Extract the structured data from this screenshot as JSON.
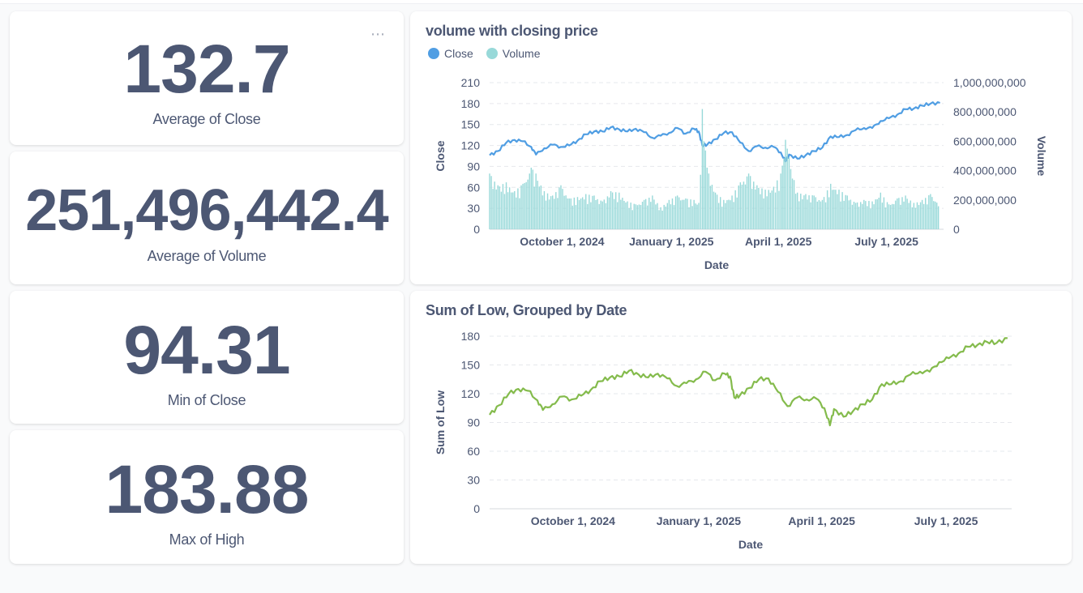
{
  "scalars": {
    "avg_close": {
      "value": "132.7",
      "label": "Average of Close"
    },
    "avg_volume": {
      "value": "251,496,442.4",
      "label": "Average of Volume"
    },
    "min_close": {
      "value": "94.31",
      "label": "Min of Close"
    },
    "max_high": {
      "value": "183.88",
      "label": "Max of High"
    }
  },
  "card_menu_icon": "ellipsis-icon",
  "colors": {
    "close": "#509ee3",
    "volume": "#98d9d9",
    "low": "#84bb4c",
    "text": "#4c5773",
    "grid": "#e6e8ec"
  },
  "chart_data": [
    {
      "type": "line",
      "title": "volume with closing price",
      "legend": [
        "Close",
        "Volume"
      ],
      "legend_position": "top-left",
      "xlabel": "Date",
      "ylabel": "Close",
      "y2label": "Volume",
      "x_ticks": [
        "October 1, 2024",
        "January 1, 2025",
        "April 1, 2025",
        "July 1, 2025"
      ],
      "y_ticks": [
        "0",
        "30",
        "60",
        "90",
        "120",
        "150",
        "180",
        "210"
      ],
      "y2_ticks": [
        "0",
        "200,000,000",
        "400,000,000",
        "600,000,000",
        "800,000,000",
        "1,000,000,000"
      ],
      "ylim": [
        0,
        210
      ],
      "y2lim": [
        0,
        1000000000
      ],
      "xlim": [
        "2024-08-01",
        "2025-08-18"
      ],
      "grid": true,
      "series": [
        {
          "name": "Close",
          "kind": "line",
          "axis": "left",
          "points": [
            [
              "2024-08-01",
              106
            ],
            [
              "2024-08-08",
              112
            ],
            [
              "2024-08-15",
              124
            ],
            [
              "2024-08-22",
              128
            ],
            [
              "2024-08-29",
              126
            ],
            [
              "2024-09-05",
              118
            ],
            [
              "2024-09-09",
              107
            ],
            [
              "2024-09-16",
              116
            ],
            [
              "2024-09-23",
              121
            ],
            [
              "2024-09-30",
              118
            ],
            [
              "2024-10-07",
              120
            ],
            [
              "2024-10-14",
              127
            ],
            [
              "2024-10-21",
              136
            ],
            [
              "2024-10-28",
              140
            ],
            [
              "2024-11-04",
              140
            ],
            [
              "2024-11-11",
              146
            ],
            [
              "2024-11-18",
              143
            ],
            [
              "2024-11-25",
              140
            ],
            [
              "2024-12-02",
              144
            ],
            [
              "2024-12-09",
              139
            ],
            [
              "2024-12-16",
              131
            ],
            [
              "2024-12-23",
              134
            ],
            [
              "2024-12-30",
              138
            ],
            [
              "2025-01-06",
              145
            ],
            [
              "2025-01-13",
              137
            ],
            [
              "2025-01-20",
              144
            ],
            [
              "2025-01-24",
              140
            ],
            [
              "2025-01-27",
              120
            ],
            [
              "2025-01-31",
              121
            ],
            [
              "2025-02-07",
              129
            ],
            [
              "2025-02-14",
              138
            ],
            [
              "2025-02-21",
              139
            ],
            [
              "2025-02-28",
              124
            ],
            [
              "2025-03-07",
              112
            ],
            [
              "2025-03-14",
              119
            ],
            [
              "2025-03-21",
              117
            ],
            [
              "2025-03-28",
              118
            ],
            [
              "2025-04-03",
              110
            ],
            [
              "2025-04-07",
              97
            ],
            [
              "2025-04-10",
              107
            ],
            [
              "2025-04-17",
              101
            ],
            [
              "2025-04-24",
              106
            ],
            [
              "2025-05-01",
              112
            ],
            [
              "2025-05-08",
              117
            ],
            [
              "2025-05-15",
              133
            ],
            [
              "2025-05-22",
              132
            ],
            [
              "2025-05-29",
              135
            ],
            [
              "2025-06-05",
              142
            ],
            [
              "2025-06-12",
              145
            ],
            [
              "2025-06-19",
              145
            ],
            [
              "2025-06-26",
              155
            ],
            [
              "2025-07-03",
              159
            ],
            [
              "2025-07-10",
              164
            ],
            [
              "2025-07-17",
              172
            ],
            [
              "2025-07-24",
              173
            ],
            [
              "2025-07-31",
              177
            ],
            [
              "2025-08-07",
              180
            ],
            [
              "2025-08-15",
              181
            ]
          ]
        },
        {
          "name": "Volume",
          "kind": "bar",
          "axis": "right",
          "points": [
            [
              "2024-08-01",
              380000000
            ],
            [
              "2024-08-08",
              300000000
            ],
            [
              "2024-08-15",
              320000000
            ],
            [
              "2024-08-22",
              260000000
            ],
            [
              "2024-08-29",
              310000000
            ],
            [
              "2024-09-05",
              420000000
            ],
            [
              "2024-09-09",
              380000000
            ],
            [
              "2024-09-16",
              260000000
            ],
            [
              "2024-09-23",
              230000000
            ],
            [
              "2024-09-30",
              300000000
            ],
            [
              "2024-10-07",
              210000000
            ],
            [
              "2024-10-14",
              220000000
            ],
            [
              "2024-10-21",
              240000000
            ],
            [
              "2024-10-28",
              230000000
            ],
            [
              "2024-11-04",
              190000000
            ],
            [
              "2024-11-11",
              260000000
            ],
            [
              "2024-11-18",
              250000000
            ],
            [
              "2024-11-25",
              190000000
            ],
            [
              "2024-12-02",
              170000000
            ],
            [
              "2024-12-09",
              200000000
            ],
            [
              "2024-12-16",
              230000000
            ],
            [
              "2024-12-23",
              150000000
            ],
            [
              "2024-12-30",
              200000000
            ],
            [
              "2025-01-06",
              230000000
            ],
            [
              "2025-01-13",
              210000000
            ],
            [
              "2025-01-20",
              200000000
            ],
            [
              "2025-01-24",
              180000000
            ],
            [
              "2025-01-27",
              820000000
            ],
            [
              "2025-01-31",
              420000000
            ],
            [
              "2025-02-07",
              250000000
            ],
            [
              "2025-02-14",
              200000000
            ],
            [
              "2025-02-21",
              230000000
            ],
            [
              "2025-02-28",
              320000000
            ],
            [
              "2025-03-07",
              380000000
            ],
            [
              "2025-03-14",
              300000000
            ],
            [
              "2025-03-21",
              270000000
            ],
            [
              "2025-03-28",
              290000000
            ],
            [
              "2025-04-03",
              380000000
            ],
            [
              "2025-04-07",
              610000000
            ],
            [
              "2025-04-10",
              490000000
            ],
            [
              "2025-04-17",
              250000000
            ],
            [
              "2025-04-24",
              240000000
            ],
            [
              "2025-05-01",
              230000000
            ],
            [
              "2025-05-08",
              200000000
            ],
            [
              "2025-05-15",
              310000000
            ],
            [
              "2025-05-22",
              270000000
            ],
            [
              "2025-05-29",
              230000000
            ],
            [
              "2025-06-05",
              180000000
            ],
            [
              "2025-06-12",
              200000000
            ],
            [
              "2025-06-19",
              190000000
            ],
            [
              "2025-06-26",
              250000000
            ],
            [
              "2025-07-03",
              170000000
            ],
            [
              "2025-07-10",
              210000000
            ],
            [
              "2025-07-17",
              230000000
            ],
            [
              "2025-07-24",
              180000000
            ],
            [
              "2025-07-31",
              200000000
            ],
            [
              "2025-08-07",
              240000000
            ],
            [
              "2025-08-15",
              170000000
            ]
          ]
        }
      ]
    },
    {
      "type": "line",
      "title": "Sum of Low, Grouped by Date",
      "xlabel": "Date",
      "ylabel": "Sum of Low",
      "x_ticks": [
        "October 1, 2024",
        "January 1, 2025",
        "April 1, 2025",
        "July 1, 2025"
      ],
      "y_ticks": [
        "0",
        "30",
        "60",
        "90",
        "120",
        "150",
        "180"
      ],
      "ylim": [
        0,
        180
      ],
      "xlim": [
        "2024-08-01",
        "2025-08-18"
      ],
      "grid": true,
      "series": [
        {
          "name": "Sum of Low",
          "kind": "line",
          "axis": "left",
          "points": [
            [
              "2024-08-01",
              98
            ],
            [
              "2024-08-08",
              108
            ],
            [
              "2024-08-15",
              120
            ],
            [
              "2024-08-22",
              125
            ],
            [
              "2024-08-29",
              123
            ],
            [
              "2024-09-05",
              113
            ],
            [
              "2024-09-09",
              103
            ],
            [
              "2024-09-16",
              109
            ],
            [
              "2024-09-23",
              117
            ],
            [
              "2024-09-30",
              114
            ],
            [
              "2024-10-07",
              118
            ],
            [
              "2024-10-14",
              124
            ],
            [
              "2024-10-21",
              133
            ],
            [
              "2024-10-28",
              137
            ],
            [
              "2024-11-04",
              138
            ],
            [
              "2024-11-11",
              144
            ],
            [
              "2024-11-18",
              140
            ],
            [
              "2024-11-25",
              137
            ],
            [
              "2024-12-02",
              141
            ],
            [
              "2024-12-09",
              136
            ],
            [
              "2024-12-16",
              128
            ],
            [
              "2024-12-23",
              131
            ],
            [
              "2024-12-30",
              135
            ],
            [
              "2025-01-06",
              143
            ],
            [
              "2025-01-13",
              134
            ],
            [
              "2025-01-20",
              141
            ],
            [
              "2025-01-24",
              138
            ],
            [
              "2025-01-27",
              116
            ],
            [
              "2025-01-31",
              118
            ],
            [
              "2025-02-07",
              126
            ],
            [
              "2025-02-14",
              135
            ],
            [
              "2025-02-21",
              136
            ],
            [
              "2025-02-28",
              122
            ],
            [
              "2025-03-07",
              107
            ],
            [
              "2025-03-14",
              116
            ],
            [
              "2025-03-21",
              114
            ],
            [
              "2025-03-28",
              115
            ],
            [
              "2025-04-03",
              105
            ],
            [
              "2025-04-07",
              87
            ],
            [
              "2025-04-10",
              104
            ],
            [
              "2025-04-17",
              96
            ],
            [
              "2025-04-24",
              102
            ],
            [
              "2025-05-01",
              109
            ],
            [
              "2025-05-08",
              114
            ],
            [
              "2025-05-15",
              130
            ],
            [
              "2025-05-22",
              130
            ],
            [
              "2025-05-29",
              133
            ],
            [
              "2025-06-05",
              140
            ],
            [
              "2025-06-12",
              143
            ],
            [
              "2025-06-19",
              143
            ],
            [
              "2025-06-26",
              153
            ],
            [
              "2025-07-03",
              157
            ],
            [
              "2025-07-10",
              162
            ],
            [
              "2025-07-17",
              169
            ],
            [
              "2025-07-24",
              171
            ],
            [
              "2025-07-31",
              174
            ],
            [
              "2025-08-07",
              173
            ],
            [
              "2025-08-15",
              178
            ]
          ]
        }
      ]
    }
  ]
}
